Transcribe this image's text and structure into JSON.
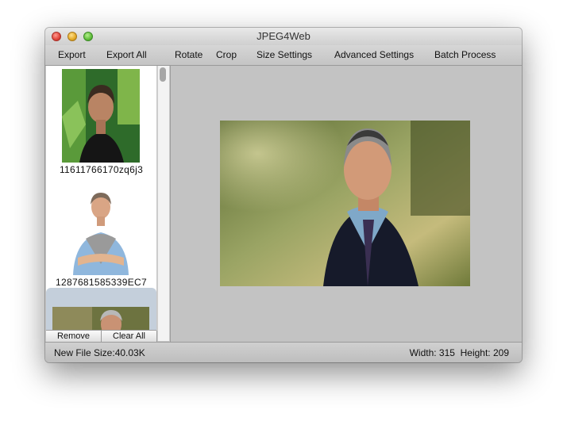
{
  "window": {
    "title": "JPEG4Web"
  },
  "toolbar": {
    "export": "Export",
    "export_all": "Export All",
    "rotate": "Rotate",
    "crop": "Crop",
    "size_settings": "Size Settings",
    "advanced_settings": "Advanced Settings",
    "batch_process": "Batch Process"
  },
  "thumbnails": [
    {
      "caption": "11611766170zq6j3",
      "selected": false
    },
    {
      "caption": "1287681585339EC7",
      "selected": false
    },
    {
      "caption": "",
      "selected": true
    }
  ],
  "panel_buttons": {
    "remove": "Remove",
    "clear_all": "Clear All"
  },
  "status": {
    "file_size": "New File Size:40.03K",
    "dimensions": "Width: 315  Height: 209"
  }
}
